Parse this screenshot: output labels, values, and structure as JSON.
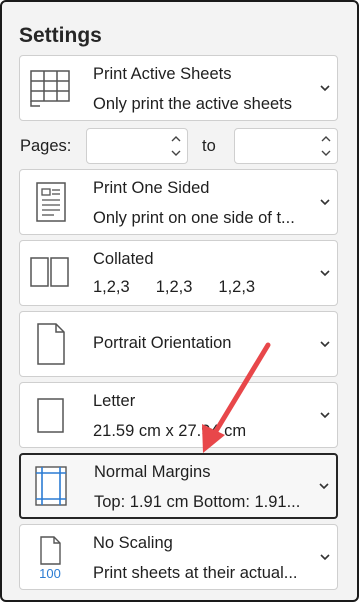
{
  "heading": "Settings",
  "sheets": {
    "title": "Print Active Sheets",
    "subtitle": "Only print the active sheets"
  },
  "pages": {
    "label": "Pages:",
    "to_label": "to",
    "from_value": "",
    "to_value": ""
  },
  "sides": {
    "title": "Print One Sided",
    "subtitle": "Only print on one side of t..."
  },
  "collation": {
    "title": "Collated",
    "sequence": [
      "1,2,3",
      "1,2,3",
      "1,2,3"
    ]
  },
  "orientation": {
    "title": "Portrait Orientation"
  },
  "paper": {
    "title": "Letter",
    "subtitle": "21.59 cm x 27.94 cm"
  },
  "margins": {
    "title": "Normal Margins",
    "subtitle": "Top: 1.91 cm Bottom: 1.91...",
    "selected": true
  },
  "scaling": {
    "title": "No Scaling",
    "subtitle": "Print sheets at their actual...",
    "icon_label": "100"
  },
  "colors": {
    "accent_blue": "#2b7cd3",
    "arrow_red": "#e8474a",
    "border": "#cfcfcf"
  }
}
